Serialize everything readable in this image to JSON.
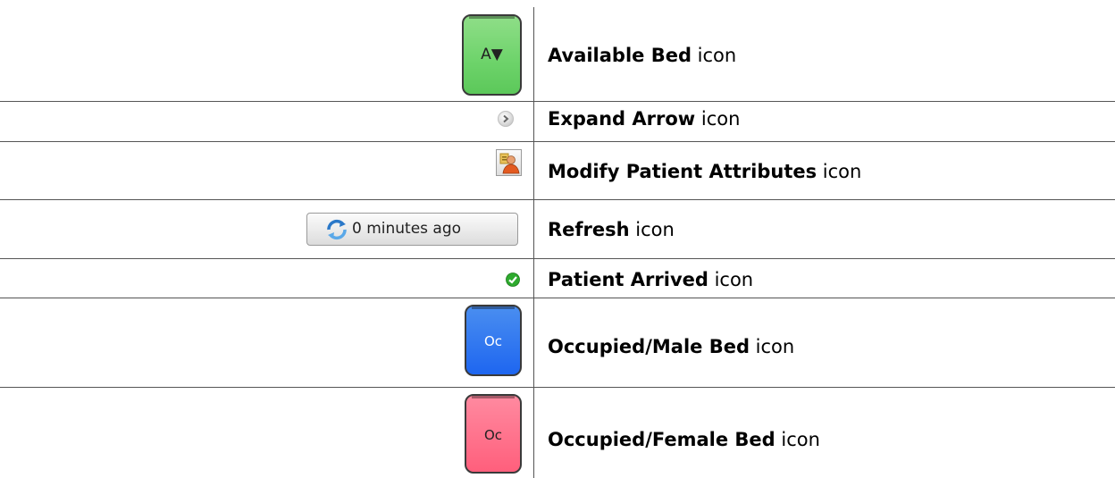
{
  "rows": [
    {
      "icon_name": "available-bed-icon",
      "icon_text": "A▼",
      "label_bold": "Available Bed",
      "label_rest": " icon"
    },
    {
      "icon_name": "expand-arrow-icon",
      "label_bold": "Expand Arrow",
      "label_rest": " icon"
    },
    {
      "icon_name": "modify-patient-attributes-icon",
      "label_bold": "Modify Patient Attributes",
      "label_rest": " icon"
    },
    {
      "icon_name": "refresh-icon",
      "button_text": "0 minutes ago",
      "label_bold": "Refresh",
      "label_rest": " icon"
    },
    {
      "icon_name": "patient-arrived-icon",
      "label_bold": "Patient Arrived",
      "label_rest": " icon"
    },
    {
      "icon_name": "occupied-male-bed-icon",
      "icon_text": "Oc",
      "label_bold": "Occupied/Male Bed",
      "label_rest": " icon"
    },
    {
      "icon_name": "occupied-female-bed-icon",
      "icon_text": "Oc",
      "label_bold": "Occupied/Female Bed",
      "label_rest": " icon"
    }
  ],
  "colors": {
    "available_bed": "#6dd36a",
    "occupied_male_bed": "#1e66f0",
    "occupied_female_bed": "#ff5f7c",
    "patient_arrived": "#2eaa2e"
  }
}
